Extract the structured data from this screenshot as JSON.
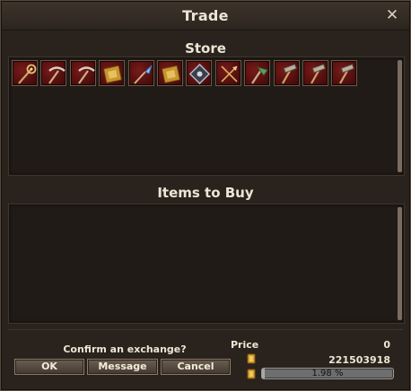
{
  "window": {
    "title": "Trade"
  },
  "store": {
    "title": "Store",
    "items": [
      {
        "icon": "magic-staff-icon"
      },
      {
        "icon": "pickaxe-icon"
      },
      {
        "icon": "pickaxe-icon"
      },
      {
        "icon": "spellbook-icon"
      },
      {
        "icon": "blue-crystal-staff-icon"
      },
      {
        "icon": "spellbook-icon"
      },
      {
        "icon": "ornate-shield-icon"
      },
      {
        "icon": "crossed-arrows-icon"
      },
      {
        "icon": "green-hatchet-icon"
      },
      {
        "icon": "hammer-icon"
      },
      {
        "icon": "hammer-icon"
      },
      {
        "icon": "hammer-icon"
      }
    ]
  },
  "buy": {
    "title": "Items to Buy"
  },
  "footer": {
    "confirm_text": "Confirm an exchange?",
    "ok_label": "OK",
    "message_label": "Message",
    "cancel_label": "Cancel",
    "price_label": "Price",
    "price_value": "0",
    "gold_value": "221503918",
    "progress_text": "1.98 %",
    "progress_fraction": 0.0198
  },
  "colors": {
    "background": "#2a231d",
    "slot": "#5a1010",
    "accent_gold": "#d8a030"
  }
}
